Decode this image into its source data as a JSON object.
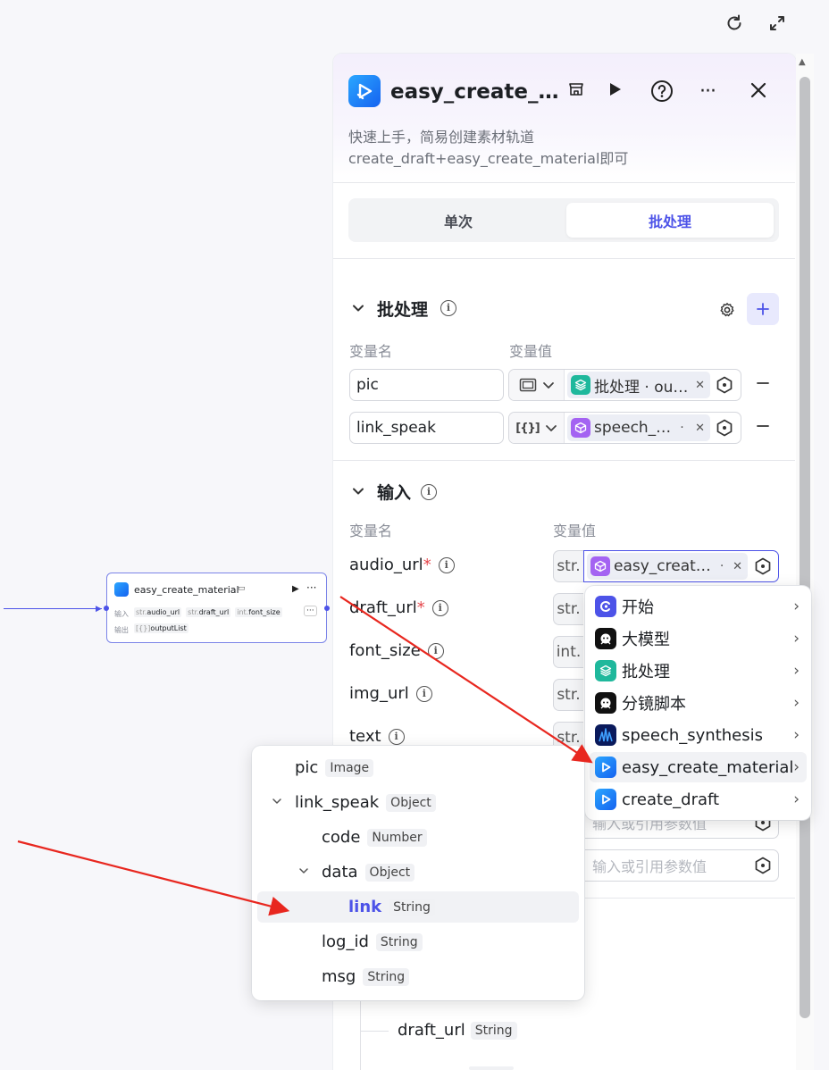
{
  "toolbar": {
    "refresh_icon": "refresh-icon",
    "fullscreen_icon": "fullscreen-icon"
  },
  "canvas_node": {
    "title": "easy_create_material",
    "input_label": "输入",
    "output_label": "输出",
    "inputs": [
      {
        "type": "str.",
        "name": "audio_url"
      },
      {
        "type": "str.",
        "name": "draft_url"
      },
      {
        "type": "int.",
        "name": "font_size"
      }
    ],
    "more": "···",
    "output": {
      "type": "[{}]",
      "name": "outputList"
    }
  },
  "panel": {
    "title": "easy_create_…",
    "description": "快速上手，简易创建素材轨道 create_draft+easy_create_material即可",
    "tabs": {
      "single": "单次",
      "batch": "批处理"
    },
    "batch_section": {
      "title": "批处理",
      "col_name": "变量名",
      "col_value": "变量值",
      "rows": [
        {
          "name": "pic",
          "type_icon": "image",
          "ref": "批处理 · ou…",
          "ref_color": "#1fb89c"
        },
        {
          "name": "link_speak",
          "type_icon": "[{}]",
          "ref": "speech_…",
          "ref_color": "#a463f2"
        }
      ]
    },
    "input_section": {
      "title": "输入",
      "col_name": "变量名",
      "col_value": "变量值",
      "rows": [
        {
          "name": "audio_url",
          "required": "*",
          "type": "str.",
          "ref": "easy_creat…"
        },
        {
          "name": "draft_url",
          "required": "*",
          "type": "str."
        },
        {
          "name": "font_size",
          "required": "",
          "type": "int."
        },
        {
          "name": "img_url",
          "required": "",
          "type": "str."
        },
        {
          "name": "text",
          "required": "",
          "type": "str."
        }
      ],
      "placeholder": "输入或引用参数值"
    },
    "output_tree": {
      "draft_url": "draft_url",
      "draft_url_type": "String"
    }
  },
  "node_dropdown": {
    "items": [
      {
        "label": "开始",
        "icon": "start-icon",
        "color": "#4d53e8"
      },
      {
        "label": "大模型",
        "icon": "llm-icon",
        "color": "#111111"
      },
      {
        "label": "批处理",
        "icon": "batch-icon",
        "color": "#1fb89c"
      },
      {
        "label": "分镜脚本",
        "icon": "storyboard-icon",
        "color": "#111111"
      },
      {
        "label": "speech_synthesis",
        "icon": "speech-synthesis-icon",
        "color": "#0a1a5c"
      },
      {
        "label": "easy_create_material",
        "icon": "easy-create-material-icon",
        "color": "#1f7cf5"
      },
      {
        "label": "create_draft",
        "icon": "create-draft-icon",
        "color": "#1f7cf5"
      }
    ]
  },
  "field_dropdown": {
    "rows": [
      {
        "name": "pic",
        "type": "Image",
        "indent": 0,
        "caret": ""
      },
      {
        "name": "link_speak",
        "type": "Object",
        "indent": 0,
        "caret": "v"
      },
      {
        "name": "code",
        "type": "Number",
        "indent": 1,
        "caret": ""
      },
      {
        "name": "data",
        "type": "Object",
        "indent": 1,
        "caret": "v"
      },
      {
        "name": "link",
        "type": "String",
        "indent": 2,
        "caret": ""
      },
      {
        "name": "log_id",
        "type": "String",
        "indent": 1,
        "caret": ""
      },
      {
        "name": "msg",
        "type": "String",
        "indent": 1,
        "caret": ""
      }
    ]
  }
}
